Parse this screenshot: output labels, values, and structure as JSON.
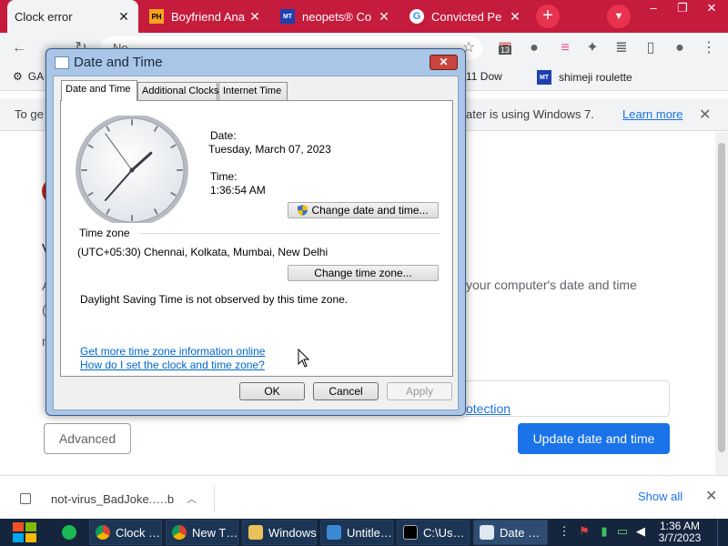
{
  "browser": {
    "tabs": [
      {
        "title": "Clock error",
        "favicon": "",
        "active": true
      },
      {
        "title": "Boyfriend Ana",
        "favicon": "PH",
        "active": false
      },
      {
        "title": "neopets® Co",
        "favicon": "MT",
        "active": false
      },
      {
        "title": "Convicted Pe",
        "favicon": "G",
        "active": false
      }
    ],
    "window_controls": {
      "minimize": "–",
      "maximize": "❐",
      "close": "✕"
    },
    "omnibox_text": "No",
    "extension_badge": "13",
    "bookmarks": [
      {
        "label": "GA",
        "icon": "gear-icon"
      },
      {
        "label": "11 Dow",
        "icon": ""
      },
      {
        "label": "shimeji roulette",
        "icon": "MT"
      }
    ],
    "infobar": {
      "text_left": "To ge",
      "text_right": "ater is using Windows 7.",
      "link": "Learn more"
    }
  },
  "page": {
    "line_v": "V",
    "line_a": "A",
    "line_a2": "(",
    "line_n": "n",
    "body_text": "your computer's date and time",
    "security_link": "otection",
    "advanced_button": "Advanced",
    "update_button": "Update date and time"
  },
  "downloads": {
    "filename": "not-virus_BadJoke.….b",
    "show_all": "Show all"
  },
  "taskbar": {
    "apps": [
      {
        "label": "",
        "icon": "spotify-icon"
      },
      {
        "label": "Clock …",
        "icon": "chrome-icon"
      },
      {
        "label": "New T…",
        "icon": "chrome-icon"
      },
      {
        "label": "Windows",
        "icon": "folder-icon"
      },
      {
        "label": "Untitle…",
        "icon": "paint-icon"
      },
      {
        "label": "C:\\Us…",
        "icon": "cmd-icon"
      },
      {
        "label": "Date …",
        "icon": "datetime-icon"
      }
    ],
    "clock_time": "1:36 AM",
    "clock_date": "3/7/2023"
  },
  "dialog": {
    "title": "Date and Time",
    "tabs": [
      "Date and Time",
      "Additional Clocks",
      "Internet Time"
    ],
    "date_label": "Date:",
    "date_value": "Tuesday, March 07, 2023",
    "time_label": "Time:",
    "time_value": "1:36:54 AM",
    "change_datetime_button": "Change date and time...",
    "timezone_label": "Time zone",
    "timezone_value": "(UTC+05:30) Chennai, Kolkata, Mumbai, New Delhi",
    "change_timezone_button": "Change time zone...",
    "dst_text": "Daylight Saving Time is not observed by this time zone.",
    "link_tz_info": "Get more time zone information online",
    "link_how_set": "How do I set the clock and time zone?",
    "ok": "OK",
    "cancel": "Cancel",
    "apply": "Apply",
    "clock_hands": {
      "hour": 1,
      "minute": 36,
      "second": 54
    }
  },
  "colors": {
    "tabstrip": "#c51b3c",
    "accent_blue": "#1a73e8",
    "taskbar": "#14253d"
  }
}
